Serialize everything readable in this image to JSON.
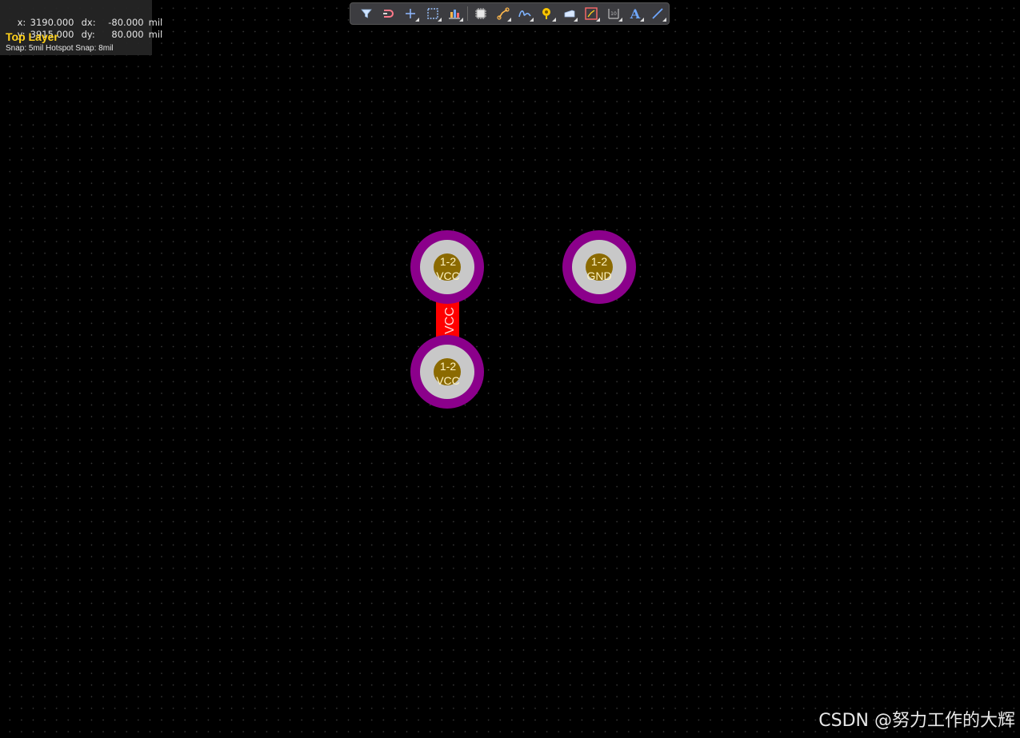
{
  "status": {
    "x_label": "x:",
    "x_value": "3190.000",
    "dx_label": "dx:",
    "dx_value": "-80.000",
    "y_label": "y:",
    "y_value": "3915.000",
    "dy_label": "dy:",
    "dy_value": "80.000",
    "unit": "mil",
    "layer": "Top Layer",
    "snap": "Snap: 5mil Hotspot Snap: 8mil"
  },
  "toolbar": {
    "tools": [
      {
        "name": "filter-icon",
        "has_menu": false
      },
      {
        "name": "interactive-route-icon",
        "has_menu": false
      },
      {
        "name": "add-icon",
        "has_menu": true
      },
      {
        "name": "select-rect-icon",
        "has_menu": true
      },
      {
        "name": "align-icon",
        "has_menu": true
      },
      {
        "name": "component-icon",
        "has_menu": false
      },
      {
        "name": "route-icon",
        "has_menu": true
      },
      {
        "name": "diff-pair-icon",
        "has_menu": true
      },
      {
        "name": "via-icon",
        "has_menu": true
      },
      {
        "name": "fill-icon",
        "has_menu": true
      },
      {
        "name": "polygon-icon",
        "has_menu": true
      },
      {
        "name": "dimension-icon",
        "has_menu": true
      },
      {
        "name": "text-icon",
        "has_menu": true
      },
      {
        "name": "line-icon",
        "has_menu": true
      }
    ],
    "text_glyph": "A"
  },
  "board": {
    "pads": [
      {
        "id": "pad-vcc-top",
        "line1": "1-2",
        "line2": "VCC"
      },
      {
        "id": "pad-gnd",
        "line1": "1-2",
        "line2": "GND"
      },
      {
        "id": "pad-vcc-bottom",
        "line1": "1-2",
        "line2": "VCC"
      }
    ],
    "track": {
      "net": "VCC"
    }
  },
  "colors": {
    "background": "#000000",
    "pad_ring": "#8b008b",
    "pad_copper": "#c8c8c8",
    "pad_hole": "#8b6a00",
    "track": "#ff0000",
    "layer_name": "#ffd11a"
  },
  "watermark": "CSDN @努力工作的大辉"
}
